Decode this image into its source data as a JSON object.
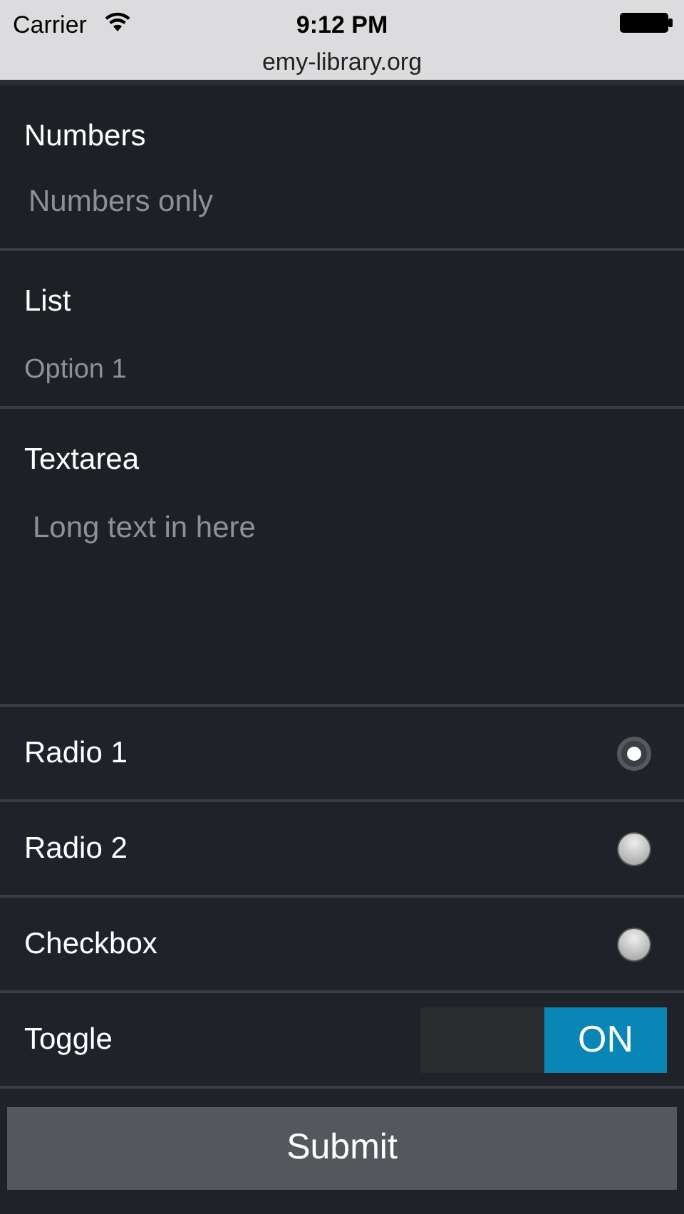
{
  "status_bar": {
    "carrier": "Carrier",
    "time": "9:12 PM",
    "url": "emy-library.org"
  },
  "fields": [
    {
      "kind": "input",
      "label": "Numbers",
      "placeholder": "Numbers only"
    },
    {
      "kind": "select",
      "label": "List",
      "value": "Option 1"
    },
    {
      "kind": "textarea",
      "label": "Textarea",
      "placeholder": "Long text in here"
    }
  ],
  "options": [
    {
      "kind": "radio",
      "label": "Radio 1",
      "selected": true
    },
    {
      "kind": "radio",
      "label": "Radio 2",
      "selected": false
    },
    {
      "kind": "checkbox",
      "label": "Checkbox",
      "checked": false
    },
    {
      "kind": "toggle",
      "label": "Toggle",
      "on": true,
      "state_label": "ON"
    }
  ],
  "submit": "Submit"
}
